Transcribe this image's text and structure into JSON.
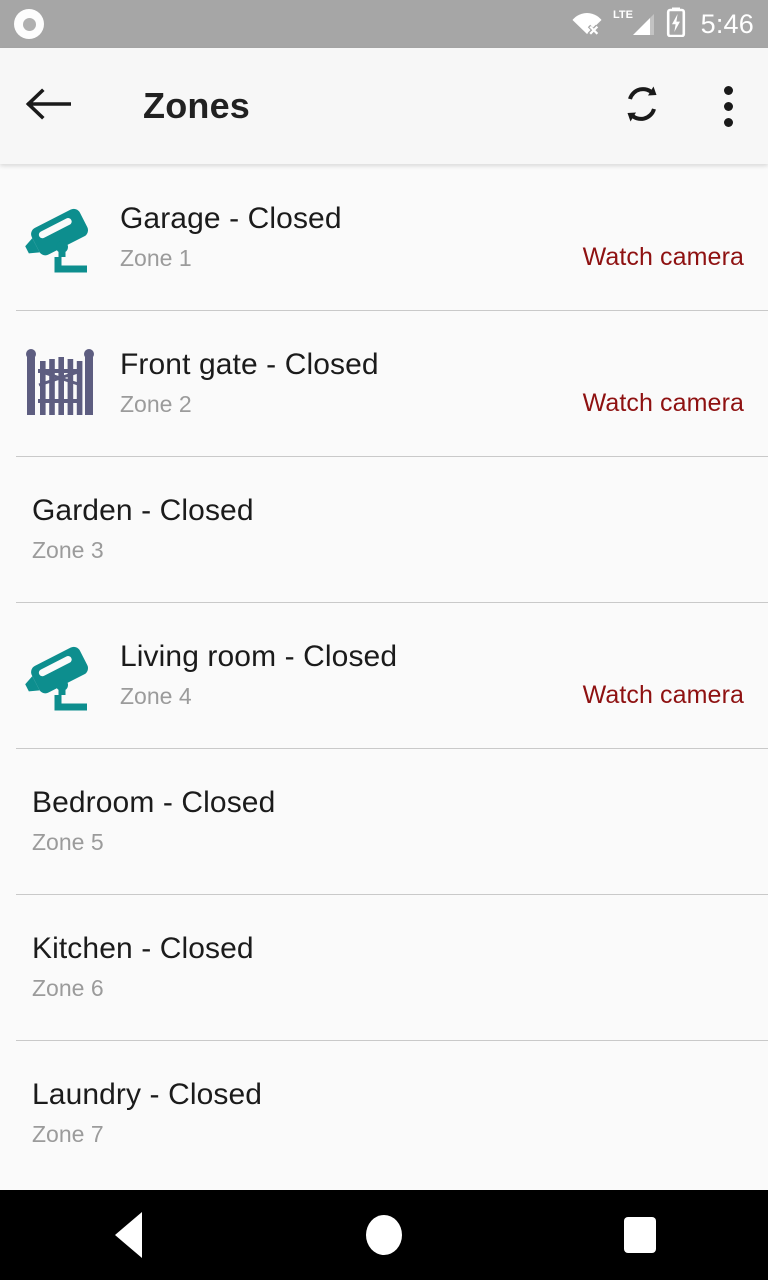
{
  "statusbar": {
    "app_icon": "circle-app-icon",
    "wifi_icon": "wifi-disconnected-icon",
    "network_label": "LTE",
    "signal_icon": "cellular-signal-icon",
    "battery_icon": "battery-charging-icon",
    "time": "5:46"
  },
  "toolbar": {
    "back_icon": "back-arrow-icon",
    "title": "Zones",
    "refresh_icon": "refresh-sync-icon",
    "overflow_icon": "overflow-menu-icon"
  },
  "list": {
    "rows": [
      {
        "title": "Garage - Closed",
        "subtitle": "Zone 1",
        "icon": "cctv-camera-icon",
        "action": "Watch camera"
      },
      {
        "title": "Front gate - Closed",
        "subtitle": "Zone 2",
        "icon": "gate-icon",
        "action": "Watch camera"
      },
      {
        "title": "Garden - Closed",
        "subtitle": "Zone 3",
        "icon": null,
        "action": null
      },
      {
        "title": "Living room - Closed",
        "subtitle": "Zone 4",
        "icon": "cctv-camera-icon",
        "action": "Watch camera"
      },
      {
        "title": "Bedroom - Closed",
        "subtitle": "Zone 5",
        "icon": null,
        "action": null
      },
      {
        "title": "Kitchen - Closed",
        "subtitle": "Zone 6",
        "icon": null,
        "action": null
      },
      {
        "title": "Laundry - Closed",
        "subtitle": "Zone 7",
        "icon": null,
        "action": null
      }
    ]
  },
  "navbar": {
    "back_icon": "nav-back-triangle-icon",
    "home_icon": "nav-home-circle-icon",
    "recents_icon": "nav-recents-square-icon"
  },
  "colors": {
    "statusbar_bg": "#a6a6a6",
    "toolbar_bg": "#f7f7f7",
    "list_bg": "#fafafa",
    "title_text": "#1b1b1b",
    "subtitle_text": "#9b9b9b",
    "action_link": "#8e1111",
    "camera_icon": "#0d8e8e",
    "gate_icon": "#5d5d80",
    "divider": "#c9c9c9",
    "navbar_bg": "#000000"
  }
}
